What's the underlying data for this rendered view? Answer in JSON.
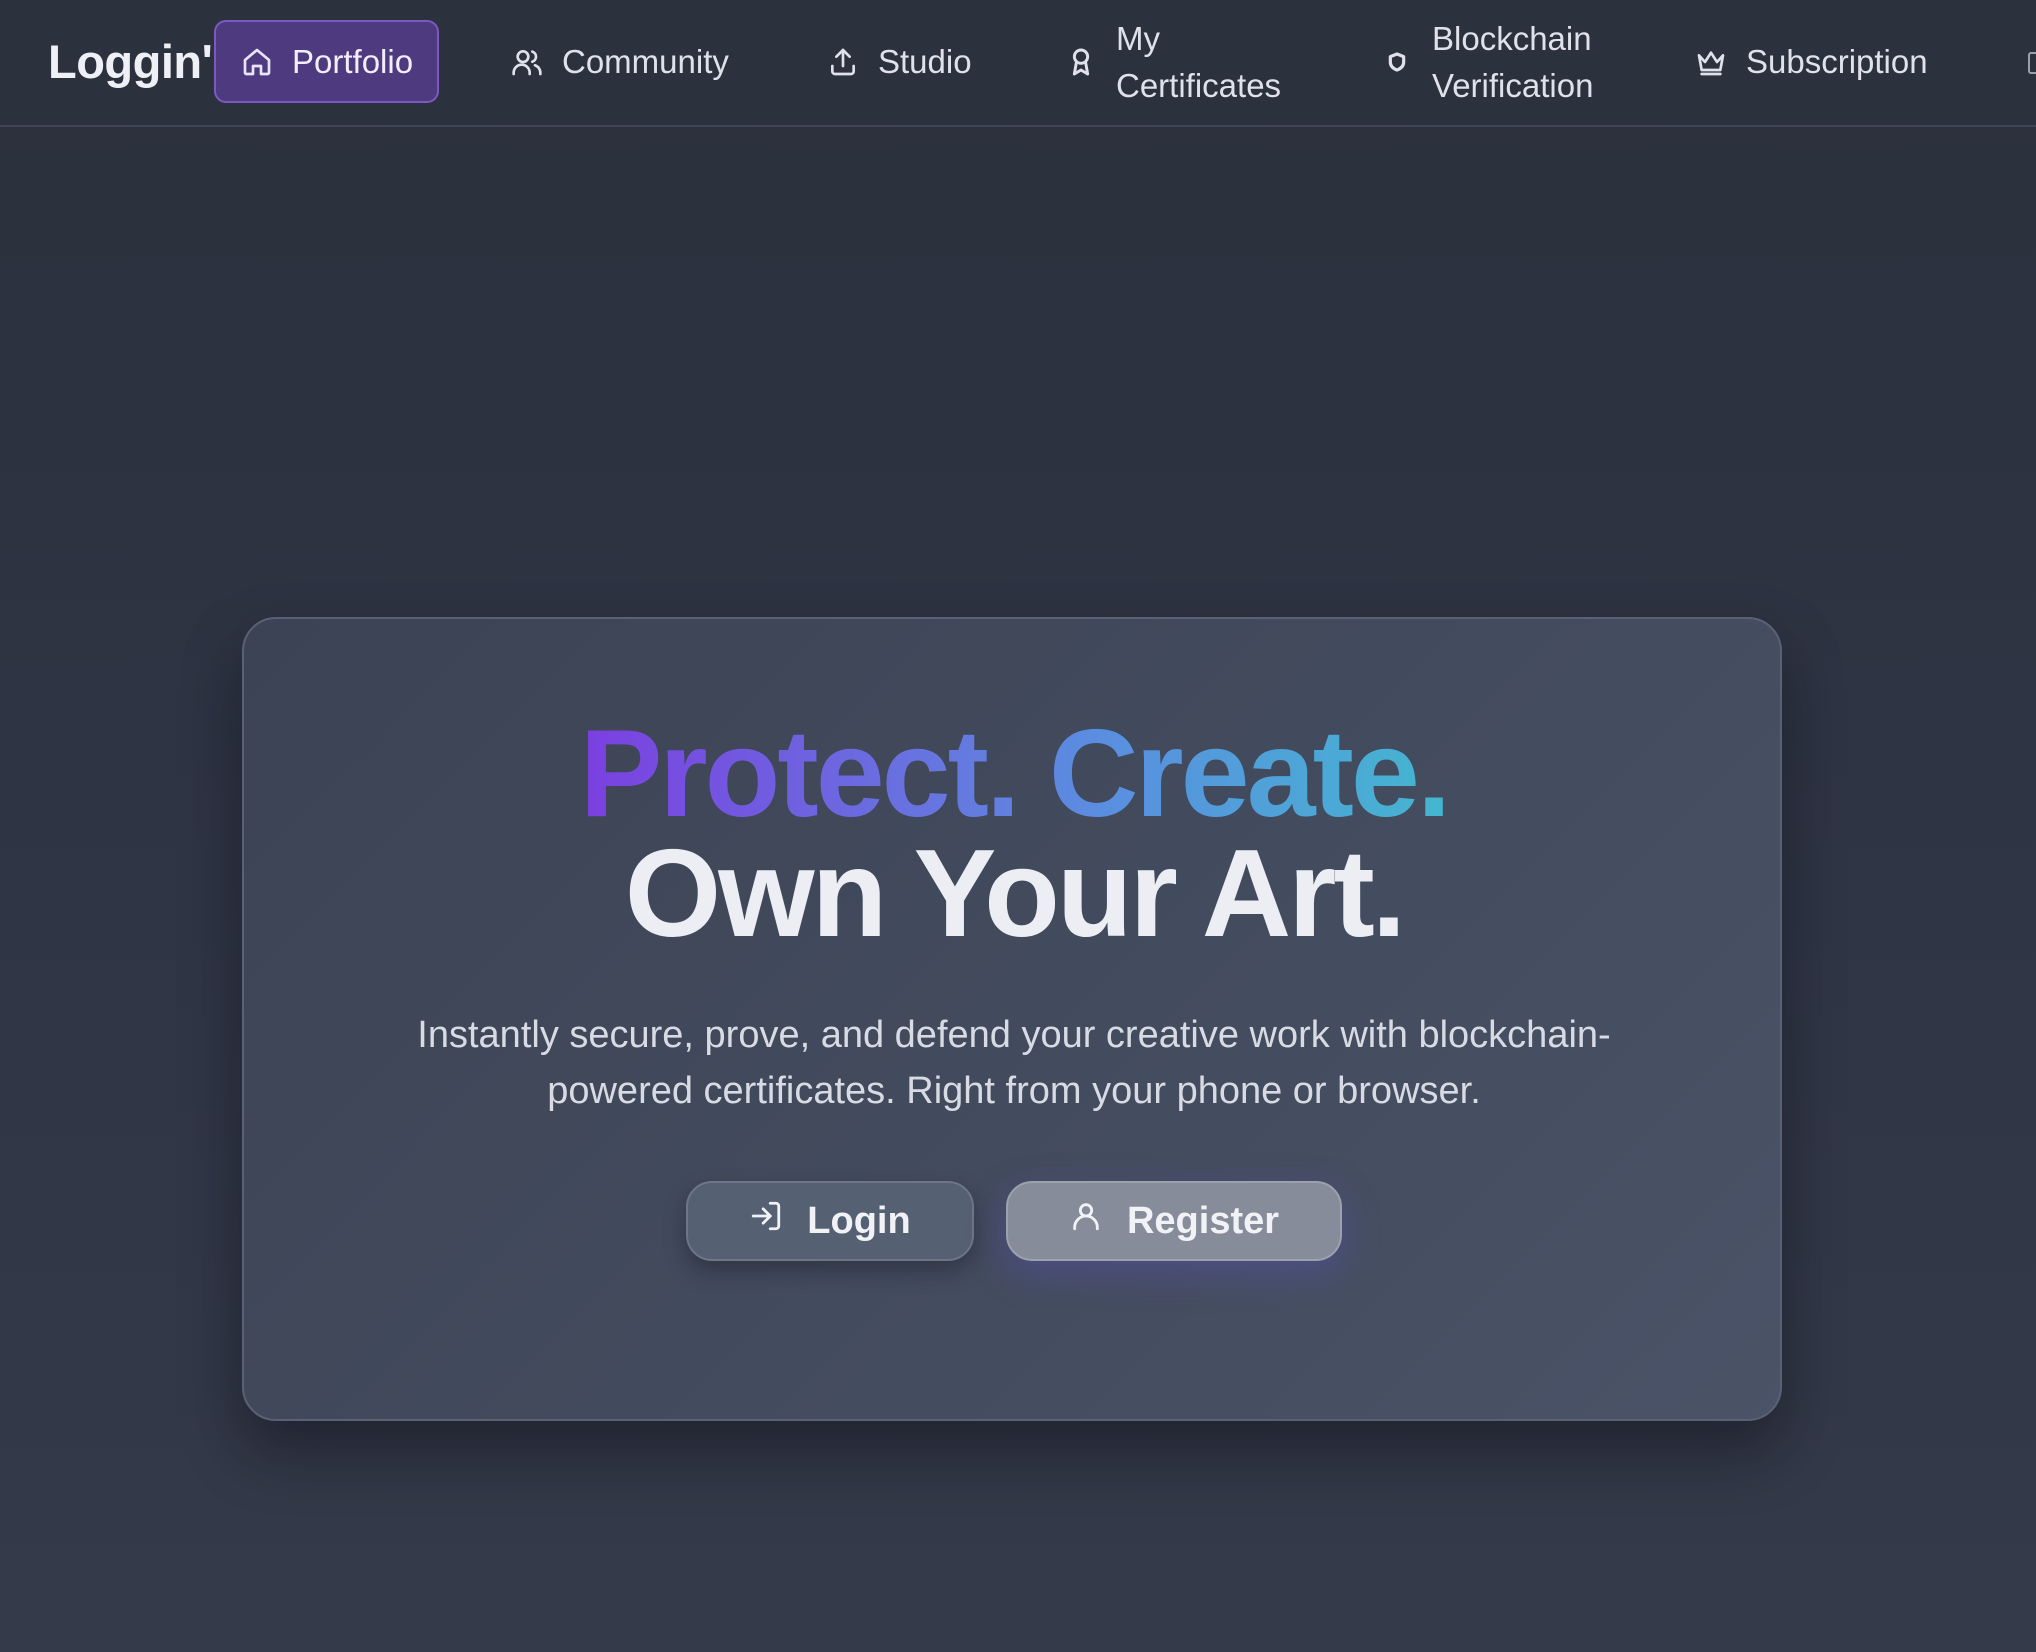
{
  "app": {
    "logo_text": "Loggin'"
  },
  "nav": {
    "items": [
      {
        "label": "Portfolio",
        "icon": "home-icon",
        "active": true
      },
      {
        "label": "Community",
        "icon": "users-icon"
      },
      {
        "label": "Studio",
        "icon": "upload-icon"
      },
      {
        "label": "My Certificates",
        "icon": "award-icon"
      },
      {
        "label": "Blockchain Verification",
        "icon": "shield-icon"
      },
      {
        "label": "Subscription",
        "icon": "crown-icon"
      }
    ]
  },
  "hero": {
    "headline_line1": "Protect. Create.",
    "headline_line2": "Own Your Art.",
    "subtitle": "Instantly secure, prove, and defend your creative work with blockchain-powered certificates. Right from your phone or browser.",
    "login_label": "Login",
    "register_label": "Register"
  },
  "colors": {
    "active_nav_bg": "#4e3a7e",
    "gradient_start": "#7b3fe0",
    "gradient_end": "#44b6d0"
  }
}
